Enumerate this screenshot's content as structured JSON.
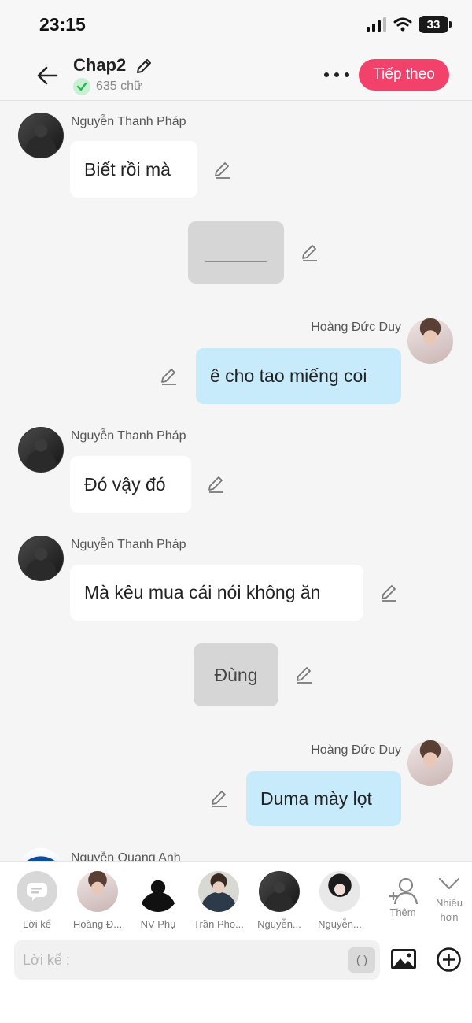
{
  "status": {
    "time": "23:15",
    "battery": "33"
  },
  "header": {
    "title": "Chap2",
    "word_count": "635 chữ",
    "next_label": "Tiếp theo"
  },
  "messages": [
    {
      "sender": "Nguyễn Thanh Pháp",
      "text": "Biết rồi mà"
    },
    {
      "text": "______"
    },
    {
      "sender": "Hoàng Đức Duy",
      "text": "ê cho tao miếng coi"
    },
    {
      "sender": "Nguyễn Thanh Pháp",
      "text": "Đó vậy đó"
    },
    {
      "sender": "Nguyễn Thanh Pháp",
      "text": "Mà kêu mua cái nói không ăn"
    },
    {
      "text": "Đùng"
    },
    {
      "sender": "Hoàng Đức Duy",
      "text": "Duma mày lọt"
    },
    {
      "sender": "Nguyễn Quang Anh"
    }
  ],
  "characters": [
    {
      "label": "Lời kể",
      "icon": "chat-bubble-icon"
    },
    {
      "label": "Hoàng Đ..."
    },
    {
      "label": "NV Phụ"
    },
    {
      "label": "Trần Pho..."
    },
    {
      "label": "Nguyễn..."
    },
    {
      "label": "Nguyễn..."
    }
  ],
  "actions": {
    "add_label": "Thêm",
    "more_label_1": "Nhiều",
    "more_label_2": "hơn"
  },
  "composer": {
    "placeholder": "Lời kể :",
    "paren_label": "( )"
  },
  "colors": {
    "accent": "#f2416a",
    "right_bubble": "#c7ebfb",
    "narration_bubble": "#d6d6d6",
    "verified": "#2bb94c"
  }
}
